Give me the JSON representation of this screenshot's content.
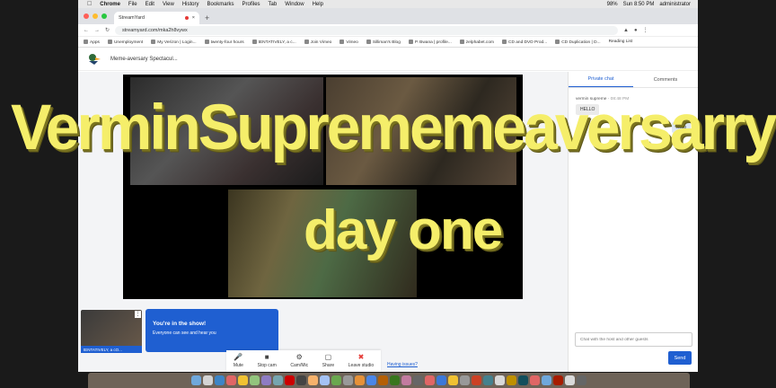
{
  "menubar": {
    "app": "Chrome",
    "items": [
      "File",
      "Edit",
      "View",
      "History",
      "Bookmarks",
      "Profiles",
      "Tab",
      "Window",
      "Help"
    ],
    "battery": "98%",
    "clock": "Sun 8:50 PM",
    "user": "administrator"
  },
  "browser": {
    "tab_title": "StreamYard",
    "url": "streamyard.com/mka2h8vywx",
    "bookmarks": [
      "Apps",
      "Unemployment",
      "My Verizon | Login...",
      "twenty-four hours",
      "tENTATIVELY, a c...",
      "Join Vimeo",
      "Vimeo",
      "Silliman's Blog",
      "P. Bwana | profile...",
      "zelphabet.com",
      "CD and DVD Prod...",
      "CD Duplication | D..."
    ],
    "reading_list": "Reading List"
  },
  "studio": {
    "broadcast_title": "Meme-aversary Spectacul...",
    "overlay_line1": "VerminSuprememeaversarry",
    "overlay_line2": "day one",
    "self_name": "tENTATIVELY, a cO...",
    "show_title": "You're in the show!",
    "show_sub": "Everyone can see and hear you",
    "controls": [
      {
        "label": "Mute",
        "icon": "microphone-icon"
      },
      {
        "label": "Stop cam",
        "icon": "camera-icon"
      },
      {
        "label": "Cam/Mic",
        "icon": "gear-icon"
      },
      {
        "label": "Share",
        "icon": "share-screen-icon"
      },
      {
        "label": "Leave studio",
        "icon": "leave-icon"
      }
    ],
    "having_issues": "Having issues?"
  },
  "chat": {
    "tabs": [
      "Private chat",
      "Comments"
    ],
    "sender": "vermin supreme",
    "time": "08:48 PM",
    "msg_in": "HELLO",
    "msg_out": "hello",
    "placeholder": "Chat with the host and other guests",
    "send": "Send"
  },
  "colors": {
    "accent": "#1f5fd1",
    "overlay_text": "#f5ee6a",
    "leave": "#e53935"
  }
}
